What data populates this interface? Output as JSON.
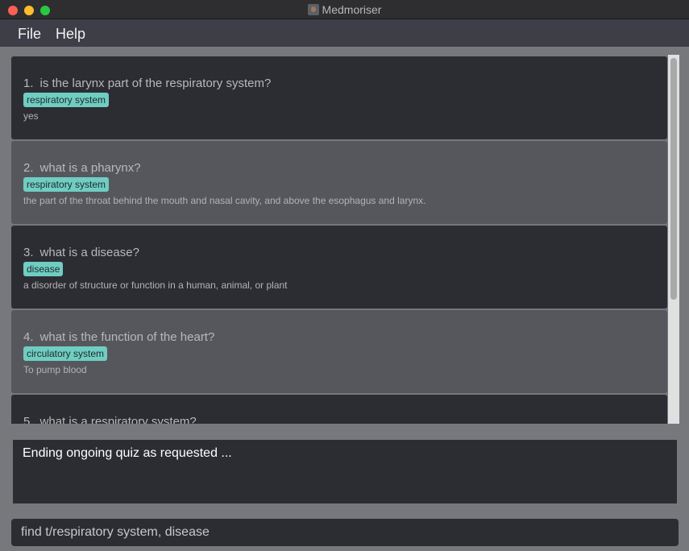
{
  "window": {
    "title": "Medmoriser",
    "traffic_lights": {
      "close": "#fe5f57",
      "minimize": "#febc2e",
      "maximize": "#28c840"
    }
  },
  "menu": {
    "items": [
      "File",
      "Help"
    ]
  },
  "questions": [
    {
      "num": "1.",
      "question": "is the larynx part of the respiratory system?",
      "tag": "respiratory system",
      "answer": "yes"
    },
    {
      "num": "2.",
      "question": "what is a pharynx?",
      "tag": "respiratory system",
      "answer": "the part of the throat behind the mouth and nasal cavity, and above the esophagus and larynx."
    },
    {
      "num": "3.",
      "question": "what is a disease?",
      "tag": "disease",
      "answer": "a disorder of structure or function in a human, animal, or plant"
    },
    {
      "num": "4.",
      "question": "what is the function of the heart?",
      "tag": "circulatory system",
      "answer": "To pump blood"
    },
    {
      "num": "5.",
      "question": "what is a respiratory system?"
    }
  ],
  "result": {
    "text": "Ending ongoing quiz as requested ..."
  },
  "command": {
    "value": "find t/respiratory system, disease"
  },
  "colors": {
    "tag": "#6fcdc2",
    "card_dark": "#2c2d33",
    "card_light": "#56575c"
  }
}
